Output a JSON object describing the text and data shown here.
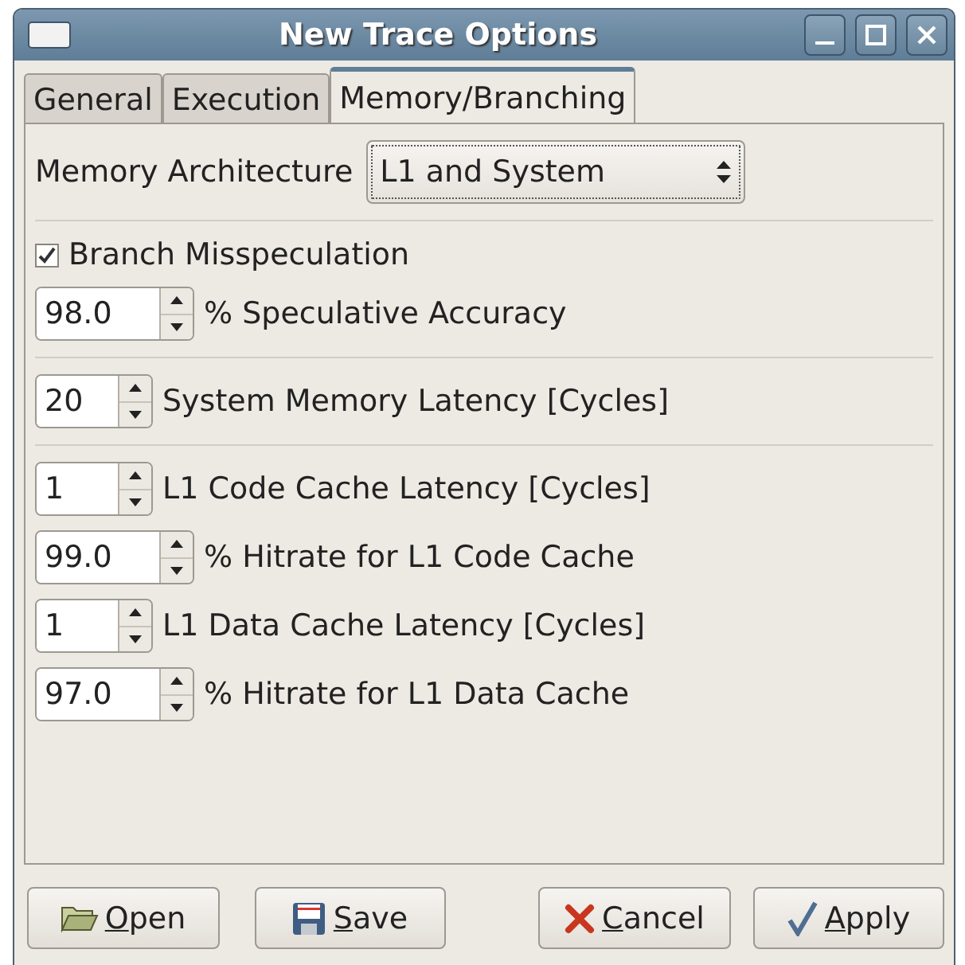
{
  "window": {
    "title": "New Trace Options"
  },
  "tabs": [
    {
      "label": "General",
      "selected": false
    },
    {
      "label": "Execution",
      "selected": false
    },
    {
      "label": "Memory/Branching",
      "selected": true
    }
  ],
  "memory_architecture": {
    "label": "Memory Architecture",
    "value": "L1 and System"
  },
  "sections": [
    {
      "checkbox": {
        "label": "Branch Misspeculation",
        "checked": true
      },
      "rows": [
        {
          "kind": "spin",
          "value": "98.0",
          "label": "% Speculative Accuracy"
        }
      ]
    },
    {
      "rows": [
        {
          "kind": "spin",
          "value": "20",
          "label": "System Memory Latency [Cycles]"
        }
      ]
    },
    {
      "rows": [
        {
          "kind": "spin",
          "value": "1",
          "label": "L1 Code Cache Latency [Cycles]"
        },
        {
          "kind": "spin",
          "value": "99.0",
          "label": "% Hitrate for L1 Code Cache"
        },
        {
          "kind": "spin",
          "value": "1",
          "label": "L1 Data Cache Latency [Cycles]"
        },
        {
          "kind": "spin",
          "value": "97.0",
          "label": "% Hitrate for L1 Data Cache"
        }
      ]
    }
  ],
  "buttons": [
    {
      "kind": "open",
      "label": "Open"
    },
    {
      "kind": "save",
      "label": "Save"
    },
    {
      "kind": "cancel",
      "label": "Cancel"
    },
    {
      "kind": "apply",
      "label": "Apply"
    }
  ]
}
